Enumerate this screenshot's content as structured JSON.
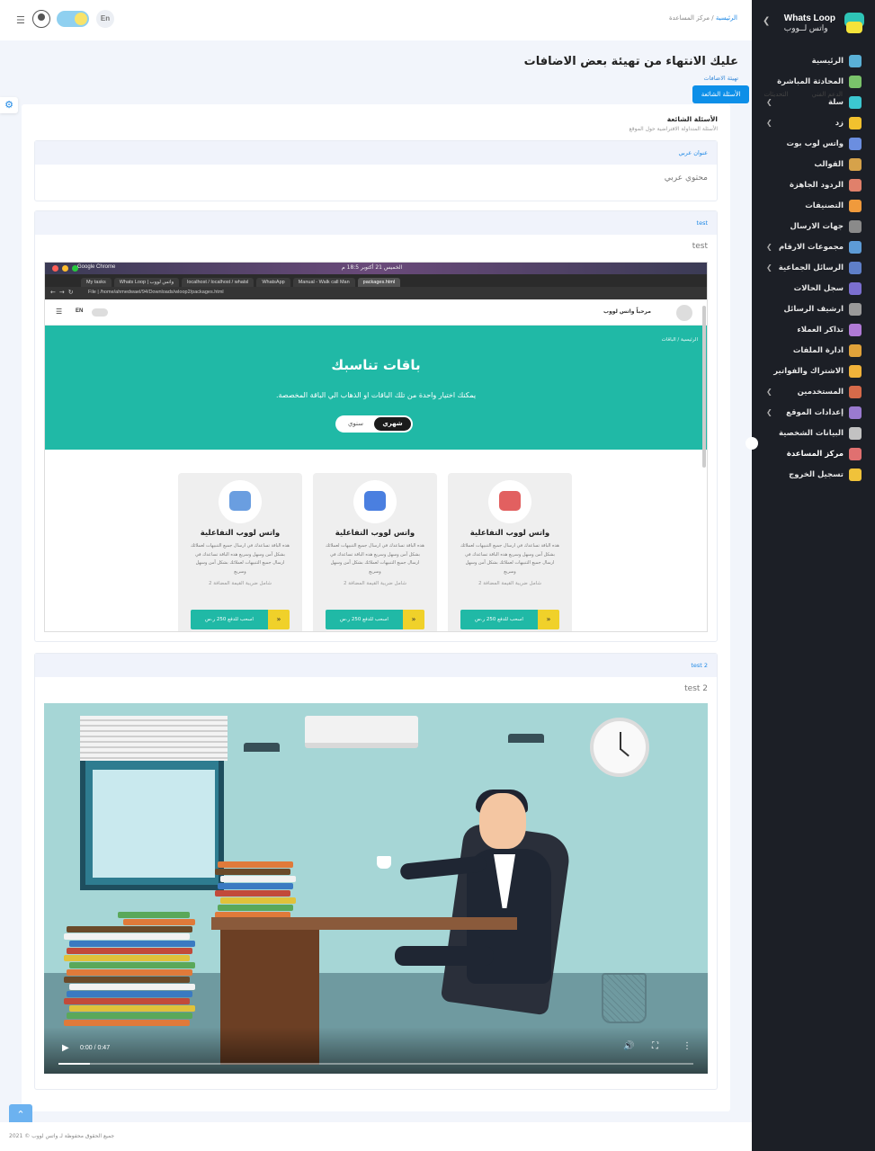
{
  "sidebar": {
    "brand_en": "Whats Loop",
    "brand_ar": "واتس لــووب",
    "items": [
      {
        "label": "الرئيسية",
        "icon": "home-icon",
        "color": "#5ab0d6",
        "arrow": false
      },
      {
        "label": "المحادثة المباشرة",
        "icon": "chat-icon",
        "color": "#7ac36a",
        "arrow": false
      },
      {
        "label": "سلة",
        "icon": "basket-icon",
        "color": "#3cc7d0",
        "arrow": true
      },
      {
        "label": "زد",
        "icon": "zid-icon",
        "color": "#f2c12e",
        "arrow": true
      },
      {
        "label": "واتس لوب بوت",
        "icon": "bot-icon",
        "color": "#6b8ee0",
        "arrow": false
      },
      {
        "label": "القوالب",
        "icon": "template-icon",
        "color": "#d6a24a",
        "arrow": false
      },
      {
        "label": "الردود الجاهزة",
        "icon": "reply-icon",
        "color": "#e0806b",
        "arrow": false
      },
      {
        "label": "التصنيفات",
        "icon": "tag-icon",
        "color": "#f09a3c",
        "arrow": false
      },
      {
        "label": "جهات الارسال",
        "icon": "contacts-icon",
        "color": "#8a8a8a",
        "arrow": false
      },
      {
        "label": "مجموعات الارقام",
        "icon": "groups-icon",
        "color": "#5d9bd6",
        "arrow": true
      },
      {
        "label": "الرسائل الجماعية",
        "icon": "broadcast-icon",
        "color": "#5f7fc8",
        "arrow": true
      },
      {
        "label": "سجل الحالات",
        "icon": "log-icon",
        "color": "#7b6fd0",
        "arrow": false
      },
      {
        "label": "ارشيف الرسائل",
        "icon": "archive-icon",
        "color": "#9a9a9a",
        "arrow": false
      },
      {
        "label": "تذاكر العملاء",
        "icon": "ticket-icon",
        "color": "#b07ad6",
        "arrow": false
      },
      {
        "label": "ادارة الملفات",
        "icon": "folder-icon",
        "color": "#e0a23a",
        "arrow": false
      },
      {
        "label": "الاشتراك والفواتير",
        "icon": "invoice-icon",
        "color": "#f0b23a",
        "arrow": false
      },
      {
        "label": "المستخدمين",
        "icon": "users-icon",
        "color": "#d66a4a",
        "arrow": true
      },
      {
        "label": "إعدادات الموقع",
        "icon": "settings-icon",
        "color": "#9a7ad0",
        "arrow": true
      },
      {
        "label": "البيانات الشخصية",
        "icon": "profile-icon",
        "color": "#c2c2c2",
        "arrow": false
      },
      {
        "label": "مركز المساعدة",
        "icon": "help-icon",
        "color": "#e07070",
        "arrow": false,
        "active": true
      },
      {
        "label": "تسجيل الخروج",
        "icon": "logout-icon",
        "color": "#f0c23a",
        "arrow": false
      }
    ]
  },
  "topbar": {
    "lang": "En",
    "crumb_home": "الرئيسية",
    "crumb_current": "مركز المساعدة"
  },
  "page": {
    "title": "عليك الانتهاء من تهيئة بعض الاضافات",
    "subtitle": "تهيئة الاضافات",
    "tabs": [
      "الدعم الفني",
      "التحديثات",
      "الأسئلة الشائعة"
    ],
    "active_tab": 2
  },
  "faq": {
    "title": "الأسئلة الشائعة",
    "subtitle": "الأسئلة المتداولة الافتراضية حول الموقع",
    "items": [
      {
        "title": "عنوان عربي",
        "content": "محتوي عربي"
      },
      {
        "title": "test",
        "content": "test"
      },
      {
        "title": "test 2",
        "content": "test 2"
      }
    ]
  },
  "embedded": {
    "os_app": "Google Chrome",
    "os_clock": "الخميس 21 أكتوبر 18:5 م",
    "tabs": [
      "My tasks",
      "Whats Loop | واتس لووب",
      "localhost / localhost / whatsl",
      "WhatsApp",
      "Manual - Walk call Man",
      "packages.html"
    ],
    "url": "File | /home/ahmedwael/94/Downloads/wloop2/packages.html",
    "site_brand": "مرحباً واتس لووب",
    "site_lang": "EN",
    "bc_home": "الرئيسية",
    "bc_page": "الباقات",
    "hero_title": "باقات تناسبك",
    "hero_text": "يمكنك اختيار واحدة من تلك الباقات او الذهاب الي الباقة المخصصة.",
    "switch_monthly": "شهري",
    "switch_yearly": "سنوي",
    "packages": [
      {
        "name": "واتس لووب التفاعلية",
        "desc": "هذه الباقة تساعدك في ارسال جميع التنبيهات لعملائك بشكل آمن وسهل وسريع هذه الباقة تساعدك في ارسال جميع التنبيهات لعملائك بشكل آمن وسهل وسريع",
        "vat": "شامل ضريبة القيمة المضافة 2",
        "btn": "اسحب للدفع 250 ر.س",
        "icon": "api-icon",
        "color": "#e26060"
      },
      {
        "name": "واتس لووب التفاعلية",
        "desc": "هذه الباقة تساعدك في ارسال جميع التنبيهات لعملائك بشكل آمن وسهل وسريع هذه الباقة تساعدك في ارسال جميع التنبيهات لعملائك بشكل آمن وسهل وسريع",
        "vat": "شامل ضريبة القيمة المضافة 2",
        "btn": "اسحب للدفع 250 ر.س",
        "icon": "message-icon",
        "color": "#4a7fe0"
      },
      {
        "name": "واتس لووب التفاعلية",
        "desc": "هذه الباقة تساعدك في ارسال جميع التنبيهات لعملائك بشكل آمن وسهل وسريع هذه الباقة تساعدك في ارسال جميع التنبيهات لعملائك بشكل آمن وسهل وسريع",
        "vat": "شامل ضريبة القيمة المضافة 2",
        "btn": "اسحب للدفع 250 ر.س",
        "icon": "agent-icon",
        "color": "#6a9ee0"
      }
    ]
  },
  "video": {
    "time": "0:00 / 0:47",
    "progress": 0.05
  },
  "footer": {
    "copyright": "جميع الحقوق محفوظة لـ واتس لووب © 2021"
  }
}
